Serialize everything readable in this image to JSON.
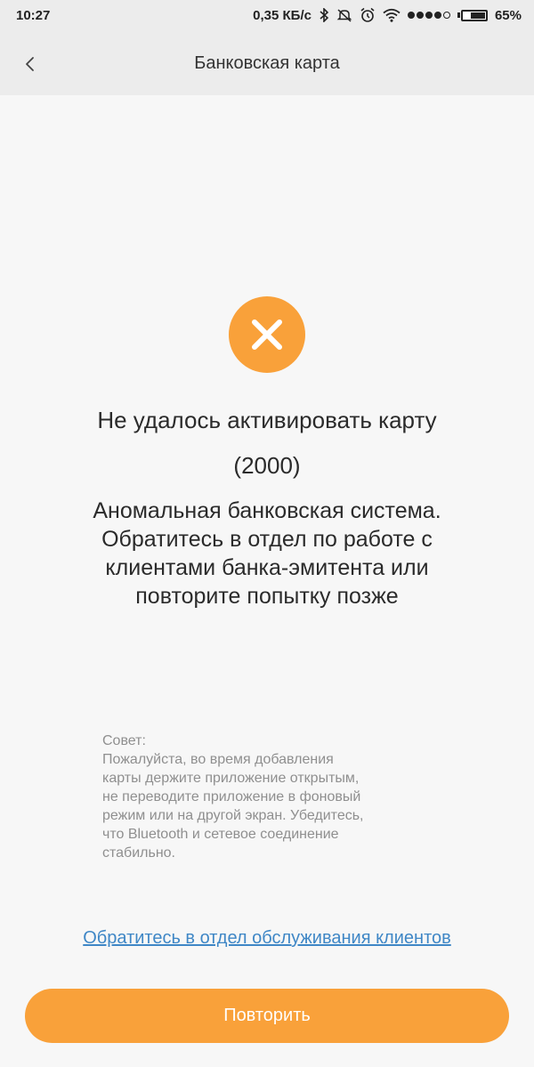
{
  "status_bar": {
    "time": "10:27",
    "network_speed": "0,35 КБ/с",
    "battery_percent": "65%",
    "battery_level": 0.65,
    "icons": [
      "bluetooth-icon",
      "mute-icon",
      "alarm-icon",
      "wifi-icon",
      "signal-icon",
      "battery-icon"
    ]
  },
  "nav": {
    "title": "Банковская карта",
    "back_icon": "chevron-left-icon"
  },
  "result": {
    "icon": "close-icon",
    "icon_color": "#f9a13a",
    "title": "Не удалось активировать карту",
    "code": "(2000)",
    "message": "Аномальная банковская система. Обратитесь в отдел по работе с клиентами банка-эмитента или повторите попытку позже"
  },
  "tip": {
    "title": "Совет:",
    "text": "Пожалуйста, во время добавления\nкарты держите приложение открытым,\nне переводите приложение в фоновый\nрежим или на другой экран. Убедитесь,\nчто Bluetooth и сетевое соединение\nстабильно."
  },
  "support_link": "Обратитесь в отдел обслуживания клиентов",
  "retry_button": "Повторить",
  "colors": {
    "accent": "#f9a13a",
    "link": "#3f87c6",
    "background": "#f7f7f7",
    "header": "#ececec"
  }
}
